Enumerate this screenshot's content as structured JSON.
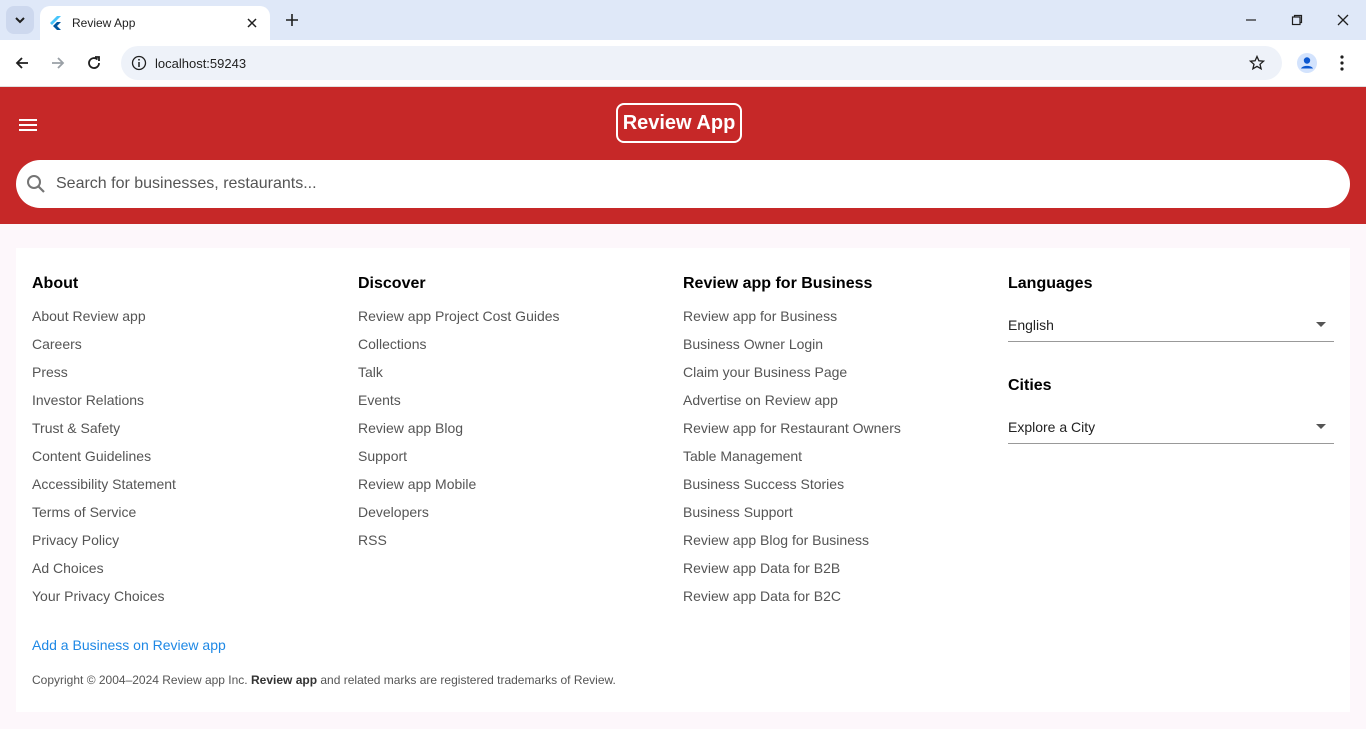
{
  "browser": {
    "tab_title": "Review App",
    "url": "localhost:59243"
  },
  "header": {
    "logo": "Review App",
    "search_placeholder": "Search for businesses, restaurants...",
    "brand_color": "#c62828"
  },
  "footer": {
    "about": {
      "title": "About",
      "links": [
        "About Review app",
        "Careers",
        "Press",
        "Investor Relations",
        "Trust & Safety",
        "Content Guidelines",
        "Accessibility Statement",
        "Terms of Service",
        "Privacy Policy",
        "Ad Choices",
        "Your Privacy Choices"
      ]
    },
    "discover": {
      "title": "Discover",
      "links": [
        "Review app Project Cost Guides",
        "Collections",
        "Talk",
        "Events",
        "Review app Blog",
        "Support",
        "Review app Mobile",
        "Developers",
        "RSS"
      ]
    },
    "business": {
      "title": "Review app for Business",
      "links": [
        "Review app for Business",
        "Business Owner Login",
        "Claim your Business Page",
        "Advertise on Review app",
        "Review app for Restaurant Owners",
        "Table Management",
        "Business Success Stories",
        "Business Support",
        "Review app Blog for Business",
        "Review app Data for B2B",
        "Review app Data for B2C"
      ]
    },
    "languages": {
      "title": "Languages",
      "selected": "English"
    },
    "cities": {
      "title": "Cities",
      "selected": "Explore a City"
    },
    "add_business": "Add a Business on Review app",
    "copyright_prefix": "Copyright © 2004–2024 Review app Inc.",
    "copyright_brand": "Review app",
    "copyright_suffix": "and related marks are registered trademarks of Review.",
    "link_color": "#1e88e5"
  }
}
